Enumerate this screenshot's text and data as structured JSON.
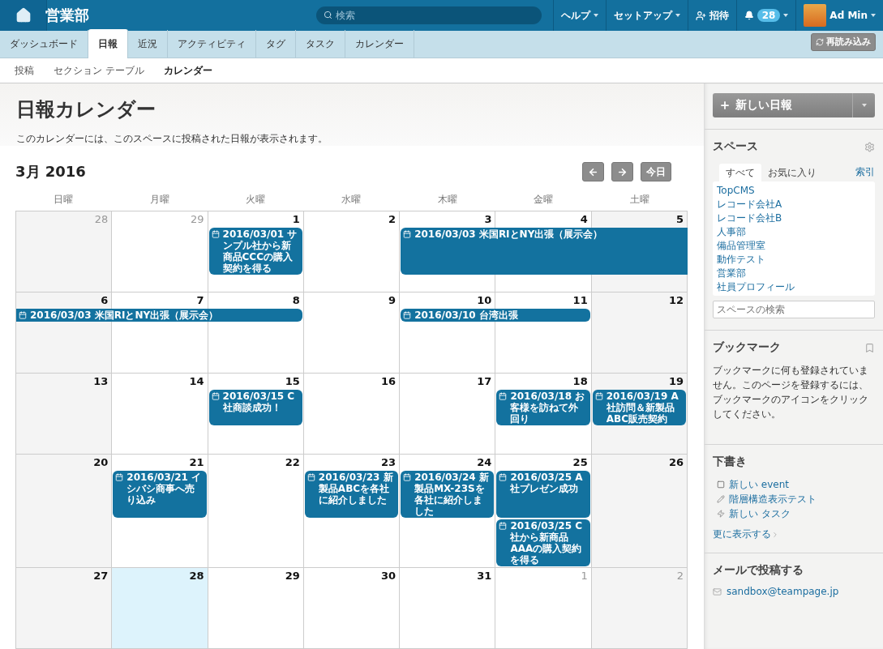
{
  "topbar": {
    "title": "営業部",
    "search": {
      "placeholder": "検索"
    },
    "menus": [
      {
        "label": "ヘルプ",
        "kind": "menu"
      },
      {
        "label": "セットアップ",
        "kind": "menu"
      },
      {
        "label": "招待",
        "kind": "invite"
      }
    ],
    "notifications": {
      "count": "28"
    },
    "user": {
      "name": "Ad Min"
    }
  },
  "tabs": [
    {
      "label": "ダッシュボード",
      "selected": false
    },
    {
      "label": "日報",
      "selected": true
    },
    {
      "label": "近況",
      "selected": false
    },
    {
      "label": "アクティビティ",
      "selected": false
    },
    {
      "label": "タグ",
      "selected": false
    },
    {
      "label": "タスク",
      "selected": false
    },
    {
      "label": "カレンダー",
      "selected": false
    }
  ],
  "reload_button": "再読み込み",
  "subnav": [
    {
      "label": "投稿",
      "selected": false
    },
    {
      "label": "セクション テーブル",
      "selected": false
    },
    {
      "label": "カレンダー",
      "selected": true
    }
  ],
  "page": {
    "title": "日報カレンダー",
    "description": "このカレンダーには、このスペースに投稿された日報が表示されます。"
  },
  "calendar": {
    "month": "3月 2016",
    "today_button": "今日",
    "weekdays": [
      "日曜",
      "月曜",
      "火曜",
      "水曜",
      "木曜",
      "金曜",
      "土曜"
    ],
    "weeks": [
      {
        "days": [
          {
            "label": "28",
            "muted": true,
            "today": false
          },
          {
            "label": "29",
            "muted": true,
            "today": false
          },
          {
            "label": "1",
            "muted": false,
            "today": false,
            "events": [
              {
                "text": "2016/03/01 サンプル社から新商品CCCの購入契約を得る",
                "kind": "box"
              }
            ]
          },
          {
            "label": "2",
            "muted": false,
            "today": false
          },
          {
            "label": "3",
            "muted": false,
            "today": false,
            "events": [
              {
                "text": "2016/03/03 米国RIとNY出張（展示会）",
                "kind": "bar"
              }
            ]
          },
          {
            "label": "4",
            "muted": false,
            "today": false,
            "events": [
              {
                "kind": "continued"
              }
            ]
          },
          {
            "label": "5",
            "muted": false,
            "today": false,
            "events": [
              {
                "kind": "continued"
              }
            ]
          }
        ]
      },
      {
        "days": [
          {
            "label": "6",
            "muted": false,
            "today": false,
            "events": [
              {
                "text": "2016/03/03 米国RIとNY出張（展示会）",
                "kind": "bar"
              }
            ]
          },
          {
            "label": "7",
            "muted": false,
            "today": false,
            "events": [
              {
                "kind": "continued"
              }
            ]
          },
          {
            "label": "8",
            "muted": false,
            "today": false,
            "events": [
              {
                "kind": "continued"
              }
            ]
          },
          {
            "label": "9",
            "muted": false,
            "today": false
          },
          {
            "label": "10",
            "muted": false,
            "today": false,
            "events": [
              {
                "text": "2016/03/10 台湾出張",
                "kind": "bar"
              }
            ]
          },
          {
            "label": "11",
            "muted": false,
            "today": false,
            "events": [
              {
                "kind": "continued"
              }
            ]
          },
          {
            "label": "12",
            "muted": false,
            "today": false
          }
        ]
      },
      {
        "days": [
          {
            "label": "13",
            "muted": false,
            "today": false
          },
          {
            "label": "14",
            "muted": false,
            "today": false
          },
          {
            "label": "15",
            "muted": false,
            "today": false,
            "events": [
              {
                "text": "2016/03/15 C社商談成功！",
                "kind": "box"
              }
            ]
          },
          {
            "label": "16",
            "muted": false,
            "today": false
          },
          {
            "label": "17",
            "muted": false,
            "today": false
          },
          {
            "label": "18",
            "muted": false,
            "today": false,
            "events": [
              {
                "text": "2016/03/18 お客様を訪ねて外回り",
                "kind": "box"
              }
            ]
          },
          {
            "label": "19",
            "muted": false,
            "today": false,
            "events": [
              {
                "text": "2016/03/19 A社訪問＆新製品ABC販売契約",
                "kind": "box"
              }
            ]
          }
        ]
      },
      {
        "days": [
          {
            "label": "20",
            "muted": false,
            "today": false
          },
          {
            "label": "21",
            "muted": false,
            "today": false,
            "events": [
              {
                "text": "2016/03/21 イシバシ商事へ売り込み",
                "kind": "box"
              }
            ]
          },
          {
            "label": "22",
            "muted": false,
            "today": false
          },
          {
            "label": "23",
            "muted": false,
            "today": false,
            "events": [
              {
                "text": "2016/03/23 新製品ABCを各社に紹介しました",
                "kind": "box"
              }
            ]
          },
          {
            "label": "24",
            "muted": false,
            "today": false,
            "events": [
              {
                "text": "2016/03/24 新製品MX-23Sを各社に紹介しました",
                "kind": "box"
              }
            ]
          },
          {
            "label": "25",
            "muted": false,
            "today": false,
            "events": [
              {
                "text": "2016/03/25 A社プレゼン成功",
                "kind": "box"
              },
              {
                "text": "2016/03/25 C社から新商品AAAの購入契約を得る",
                "kind": "box"
              }
            ]
          },
          {
            "label": "26",
            "muted": false,
            "today": false
          }
        ]
      },
      {
        "days": [
          {
            "label": "27",
            "muted": false,
            "today": false
          },
          {
            "label": "28",
            "muted": false,
            "today": true
          },
          {
            "label": "29",
            "muted": false,
            "today": false
          },
          {
            "label": "30",
            "muted": false,
            "today": false
          },
          {
            "label": "31",
            "muted": false,
            "today": false
          },
          {
            "label": "1",
            "muted": true,
            "today": false
          },
          {
            "label": "2",
            "muted": true,
            "today": false
          }
        ]
      }
    ]
  },
  "sidebar": {
    "new_button": "新しい日報",
    "spaces": {
      "title": "スペース",
      "tabs": [
        {
          "label": "すべて",
          "selected": true
        },
        {
          "label": "お気に入り",
          "selected": false
        }
      ],
      "index_link": "索引",
      "items": [
        "TopCMS",
        "レコード会社A",
        "レコード会社B",
        "人事部",
        "備品管理室",
        "動作テスト",
        "営業部",
        "社員プロフィール"
      ],
      "search_placeholder": "スペースの検索"
    },
    "bookmarks": {
      "title": "ブックマーク",
      "text": "ブックマークに何も登録されていません。このページを登録するには、ブックマークのアイコンをクリックしてください。"
    },
    "drafts": {
      "title": "下書き",
      "items": [
        {
          "label": "新しい event",
          "kind": "event"
        },
        {
          "label": "階層構造表示テスト",
          "kind": "page"
        },
        {
          "label": "新しい タスク",
          "kind": "task"
        }
      ],
      "more": "更に表示する"
    },
    "email": {
      "title": "メールで投稿する",
      "address": "sandbox@teampage.jp"
    }
  }
}
